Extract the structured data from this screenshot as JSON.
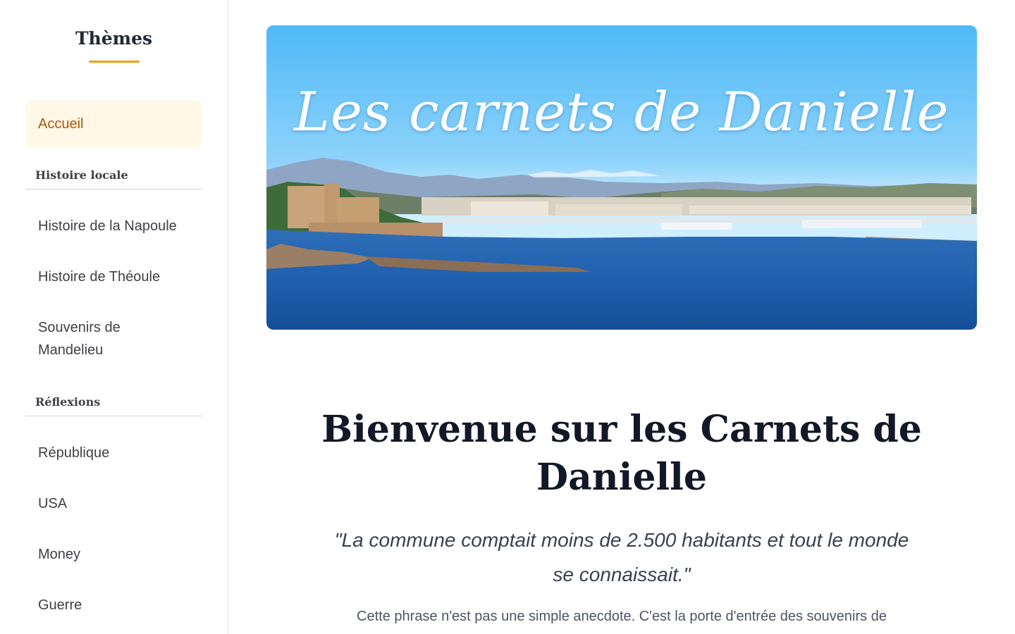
{
  "sidebar": {
    "title": "Thèmes",
    "active_item": "Accueil",
    "sections": [
      {
        "heading": "Histoire locale",
        "items": [
          "Histoire de la Napoule",
          "Histoire de Théoule",
          "Souvenirs de Mandelieu"
        ]
      },
      {
        "heading": "Réflexions",
        "items": [
          "République",
          "USA",
          "Money",
          "Guerre"
        ]
      }
    ],
    "accent_color": "#f59e0b",
    "active_bg": "#fff8e6",
    "active_color": "#b45309"
  },
  "hero": {
    "title": "Les carnets de Danielle"
  },
  "main": {
    "heading": "Bienvenue sur les Carnets de Danielle",
    "quote": "\"La commune comptait moins de 2.500 habitants et tout le monde se connaissait.\"",
    "intro": "Cette phrase n'est pas une simple anecdote. C'est la porte d'entrée des souvenirs de"
  }
}
